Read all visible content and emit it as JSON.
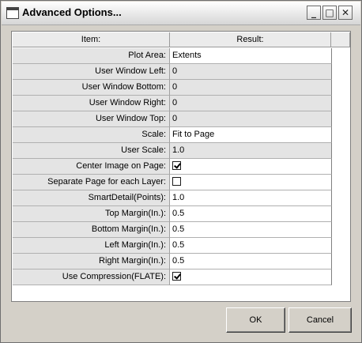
{
  "window": {
    "title": "Advanced Options..."
  },
  "grid": {
    "headers": {
      "item": "Item:",
      "result": "Result:"
    },
    "rows": [
      {
        "label": "Plot Area:",
        "value": "Extents",
        "type": "text",
        "editable": true
      },
      {
        "label": "User Window Left:",
        "value": "0",
        "type": "text",
        "editable": false
      },
      {
        "label": "User Window Bottom:",
        "value": "0",
        "type": "text",
        "editable": false
      },
      {
        "label": "User Window Right:",
        "value": "0",
        "type": "text",
        "editable": false
      },
      {
        "label": "User Window Top:",
        "value": "0",
        "type": "text",
        "editable": false
      },
      {
        "label": "Scale:",
        "value": "Fit to Page",
        "type": "text",
        "editable": true
      },
      {
        "label": "User Scale:",
        "value": "1.0",
        "type": "text",
        "editable": false
      },
      {
        "label": "Center Image on Page:",
        "value": true,
        "type": "checkbox",
        "editable": true
      },
      {
        "label": "Separate Page for each Layer:",
        "value": false,
        "type": "checkbox",
        "editable": true
      },
      {
        "label": "SmartDetail(Points):",
        "value": "1.0",
        "type": "text",
        "editable": true
      },
      {
        "label": "Top Margin(In.):",
        "value": "0.5",
        "type": "text",
        "editable": true
      },
      {
        "label": "Bottom Margin(In.):",
        "value": "0.5",
        "type": "text",
        "editable": true
      },
      {
        "label": "Left Margin(In.):",
        "value": "0.5",
        "type": "text",
        "editable": true
      },
      {
        "label": "Right Margin(In.):",
        "value": "0.5",
        "type": "text",
        "editable": true
      },
      {
        "label": "Use Compression(FLATE):",
        "value": true,
        "type": "checkbox",
        "editable": true
      }
    ]
  },
  "buttons": {
    "ok": "OK",
    "cancel": "Cancel"
  },
  "titlebar_buttons": {
    "minimize": "_",
    "maximize": "□",
    "close": "✕"
  }
}
